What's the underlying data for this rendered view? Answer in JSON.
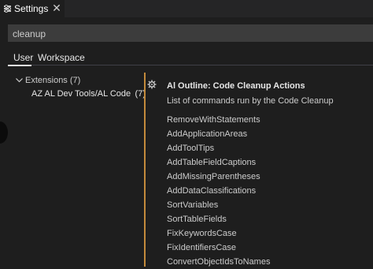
{
  "tab": {
    "label": "Settings",
    "close_glyph": "✕"
  },
  "search": {
    "value": "cleanup"
  },
  "scopes": {
    "user": "User",
    "workspace": "Workspace"
  },
  "toc": {
    "extensions": "Extensions (7)",
    "al_item": "AZ AL Dev Tools/AL Code O...",
    "al_count": "(7)"
  },
  "setting": {
    "title": "Al Outline: Code Cleanup Actions",
    "description": "List of commands run by the Code Cleanup",
    "items": [
      "RemoveWithStatements",
      "AddApplicationAreas",
      "AddToolTips",
      "AddTableFieldCaptions",
      "AddMissingParentheses",
      "AddDataClassifications",
      "SortVariables",
      "SortTableFields",
      "FixKeywordsCase",
      "FixIdentifiersCase",
      "ConvertObjectIdsToNames"
    ]
  },
  "icons": {
    "tab": "settings-file-icon",
    "close": "close-icon",
    "chevron": "chevron-down-icon",
    "gear": "gear-icon"
  },
  "colors": {
    "background": "#1e1e1e",
    "input": "#3c3c3c",
    "modified_indicator": "#c38a3b",
    "text": "#cccccc"
  }
}
